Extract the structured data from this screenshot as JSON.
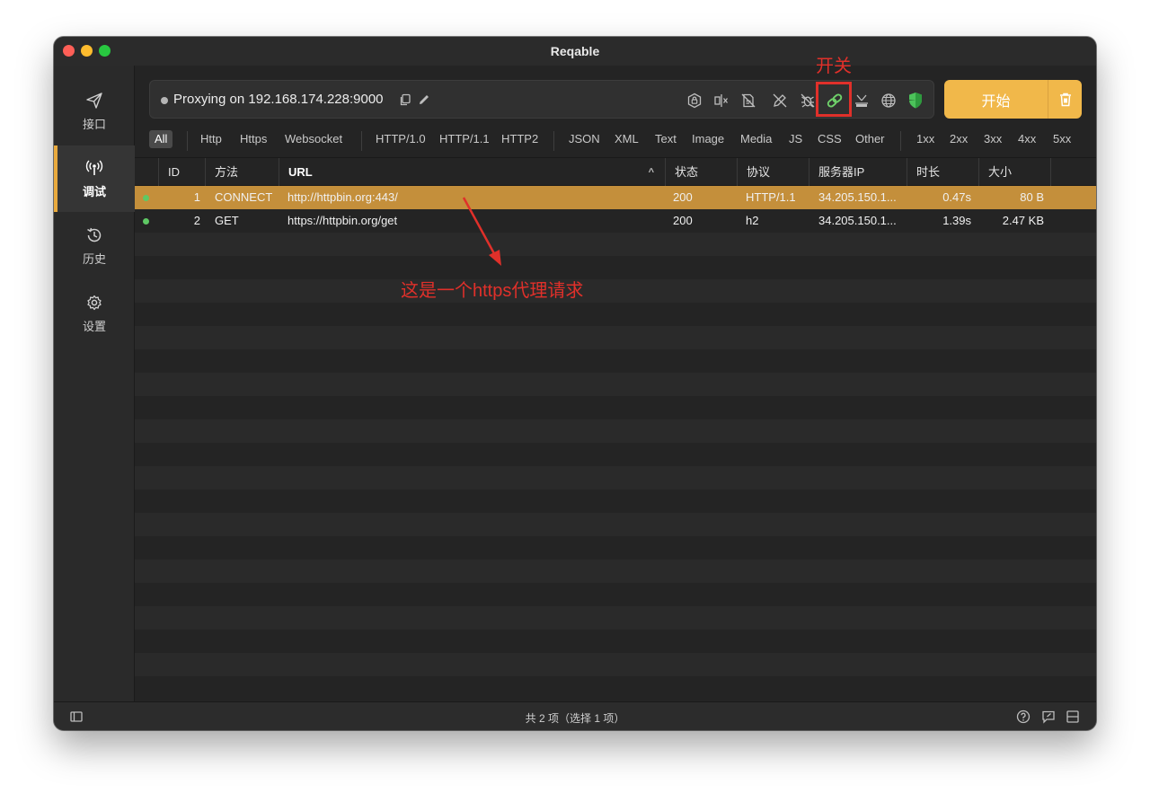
{
  "window": {
    "title": "Reqable"
  },
  "sidebar": {
    "items": [
      {
        "label": "接口",
        "icon": "send-icon"
      },
      {
        "label": "调试",
        "icon": "antenna-icon",
        "active": true
      },
      {
        "label": "历史",
        "icon": "history-icon"
      },
      {
        "label": "设置",
        "icon": "gear-icon"
      }
    ]
  },
  "proxy": {
    "status_text": "Proxying on 192.168.174.228:9000"
  },
  "toolbar": {
    "start_label": "开始",
    "icons": [
      "ssl-lock-icon",
      "breakpoint-icon",
      "rewrite-icon",
      "script-icon",
      "bug-icon",
      "link-icon",
      "mirror-icon",
      "globe-icon",
      "shield-icon",
      "trash-icon"
    ]
  },
  "filters": {
    "chips": [
      "All",
      "Http",
      "Https",
      "Websocket",
      "HTTP/1.0",
      "HTTP/1.1",
      "HTTP2",
      "JSON",
      "XML",
      "Text",
      "Image",
      "Media",
      "JS",
      "CSS",
      "Other",
      "1xx",
      "2xx",
      "3xx",
      "4xx",
      "5xx"
    ],
    "active": "All"
  },
  "table": {
    "columns": [
      "ID",
      "方法",
      "URL",
      "状态",
      "协议",
      "服务器IP",
      "时长",
      "大小"
    ],
    "sorted_column": "URL",
    "rows": [
      {
        "id": "1",
        "method": "CONNECT",
        "url": "http://httpbin.org:443/",
        "status": "200",
        "protocol": "HTTP/1.1",
        "ip": "34.205.150.1...",
        "duration": "0.47s",
        "size": "80 B",
        "selected": true
      },
      {
        "id": "2",
        "method": "GET",
        "url": "https://httpbin.org/get",
        "status": "200",
        "protocol": "h2",
        "ip": "34.205.150.1...",
        "duration": "1.39s",
        "size": "2.47 KB",
        "selected": false
      }
    ]
  },
  "footer": {
    "summary": "共 2 项（选择 1 项）"
  },
  "annotations": {
    "switch_label": "开关",
    "note": "这是一个https代理请求"
  },
  "colors": {
    "accent": "#f1b84a",
    "selected_row": "#c48f3b",
    "annotation": "#e0302a",
    "status_ok": "#5ec864"
  }
}
